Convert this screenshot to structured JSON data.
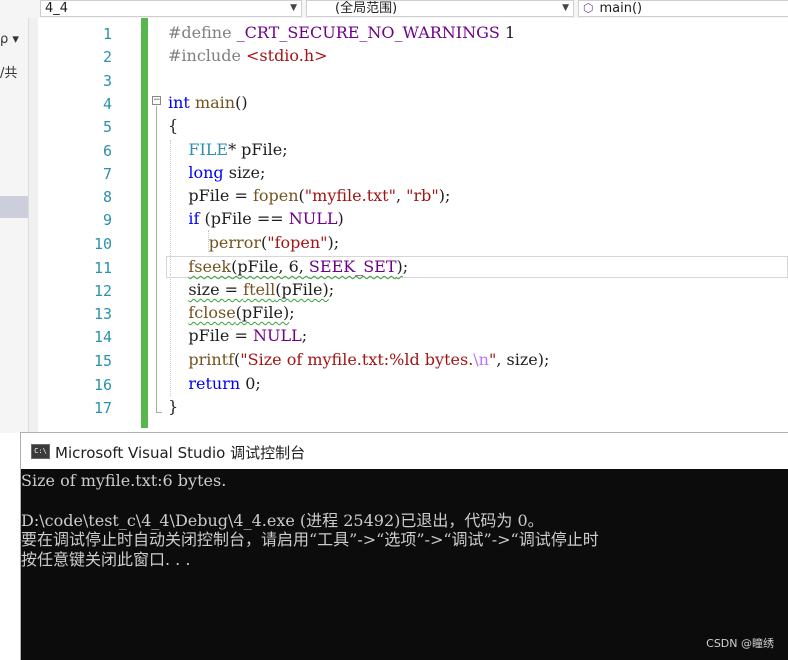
{
  "navbar": {
    "project_value": "4_4",
    "scope_value": "(全局范围)",
    "member_value": "main()"
  },
  "left_panel": {
    "icon_text": "ρ ▾",
    "fragment_text": "/共"
  },
  "editor": {
    "line_numbers": [
      "1",
      "2",
      "3",
      "4",
      "5",
      "6",
      "7",
      "8",
      "9",
      "10",
      "11",
      "12",
      "13",
      "14",
      "15",
      "16",
      "17"
    ]
  },
  "console": {
    "title": "Microsoft Visual Studio 调试控制台",
    "icon_label": "C:\\",
    "lines": [
      "Size of myfile.txt:6 bytes.",
      "",
      "D:\\code\\test_c\\4_4\\Debug\\4_4.exe (进程 25492)已退出，代码为 0。",
      "要在调试停止时自动关闭控制台，请启用“工具”->“选项”->“调试”->“调试停止时",
      "按任意键关闭此窗口. . ."
    ],
    "watermark": "CSDN @瞳绣"
  }
}
